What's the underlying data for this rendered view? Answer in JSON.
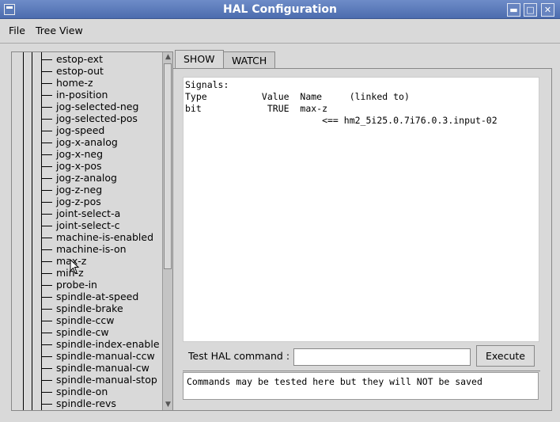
{
  "window": {
    "title": "HAL Configuration",
    "controls": [
      "minimize",
      "maximize",
      "close"
    ]
  },
  "menu": {
    "file": "File",
    "tree_view": "Tree View"
  },
  "tree": {
    "items": [
      "estop-ext",
      "estop-out",
      "home-z",
      "in-position",
      "jog-selected-neg",
      "jog-selected-pos",
      "jog-speed",
      "jog-x-analog",
      "jog-x-neg",
      "jog-x-pos",
      "jog-z-analog",
      "jog-z-neg",
      "jog-z-pos",
      "joint-select-a",
      "joint-select-c",
      "machine-is-enabled",
      "machine-is-on",
      "max-z",
      "min-z",
      "probe-in",
      "spindle-at-speed",
      "spindle-brake",
      "spindle-ccw",
      "spindle-cw",
      "spindle-index-enable",
      "spindle-manual-ccw",
      "spindle-manual-cw",
      "spindle-manual-stop",
      "spindle-on",
      "spindle-revs"
    ]
  },
  "tabs": {
    "show": "SHOW",
    "watch": "WATCH"
  },
  "show": {
    "lines": [
      "Signals:",
      "Type          Value  Name     (linked to)",
      "bit            TRUE  max-z",
      "                         <== hm2_5i25.0.7i76.0.3.input-02"
    ]
  },
  "command": {
    "label": "Test HAL command :",
    "value": "",
    "execute": "Execute",
    "note": "Commands may be tested here but they will NOT be saved"
  }
}
